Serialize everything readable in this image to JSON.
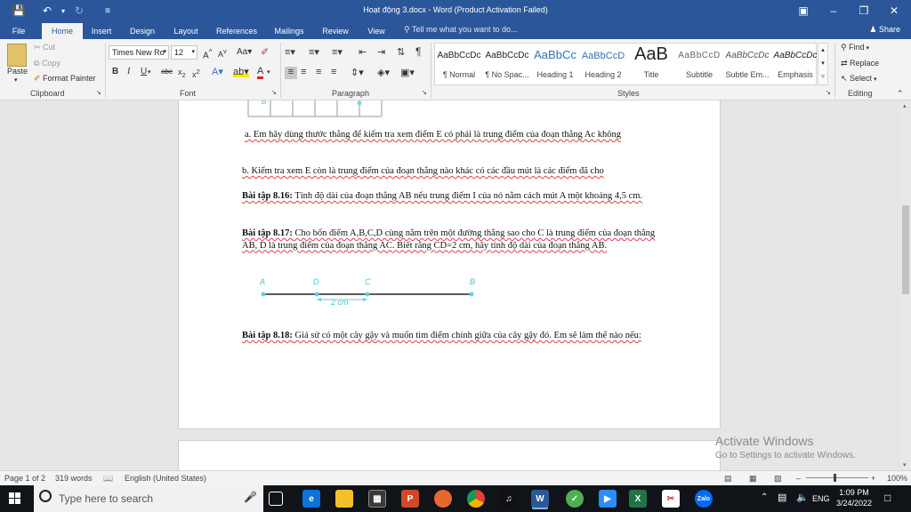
{
  "titlebar": {
    "title": "Hoạt động 3.docx - Word (Product Activation Failed)"
  },
  "tabs": {
    "file": "File",
    "home": "Home",
    "insert": "Insert",
    "design": "Design",
    "layout": "Layout",
    "references": "References",
    "mailings": "Mailings",
    "review": "Review",
    "view": "View",
    "tell_me": "Tell me what you want to do...",
    "share": "Share"
  },
  "clipboard": {
    "paste": "Paste",
    "cut": "Cut",
    "copy": "Copy",
    "format_painter": "Format Painter",
    "label": "Clipboard"
  },
  "font": {
    "family": "Times New Ro",
    "size": "12",
    "label": "Font"
  },
  "paragraph": {
    "label": "Paragraph"
  },
  "styles": {
    "label": "Styles",
    "items": [
      {
        "preview": "AaBbCcDc",
        "name": "¶ Normal"
      },
      {
        "preview": "AaBbCcDc",
        "name": "¶ No Spac..."
      },
      {
        "preview": "AaBbCc",
        "name": "Heading 1"
      },
      {
        "preview": "AaBbCcD",
        "name": "Heading 2"
      },
      {
        "preview": "AaB",
        "name": "Title"
      },
      {
        "preview": "AaBbCcD",
        "name": "Subtitle"
      },
      {
        "preview": "AaBbCcDc",
        "name": "Subtle Em..."
      },
      {
        "preview": "AaBbCcDc",
        "name": "Emphasis"
      }
    ]
  },
  "editing": {
    "find": "Find",
    "replace": "Replace",
    "select": "Select",
    "label": "Editing"
  },
  "document": {
    "p1": "a. Em hãy dùng thước thẳng để kiểm tra xem điểm E có phải là trung điểm của đoạn thẳng Ac không",
    "p2": "b. Kiểm tra xem E còn là trung điểm của đoạn thẳng nào khác có các đầu mút là các điểm đã cho",
    "p3_bold": "Bài tập 8.16:",
    "p3": " Tính độ dài của đoạn thẳng AB nếu trung điểm I của nó nằm cách mút A một khoảng 4,5 cm.",
    "p4_bold": "Bài tập 8.17:",
    "p4": " Cho bốn điểm A,B,C,D cùng nằm trên một đường thẳng sao cho C là trung điểm của đoạn thẳng AB, D là trung điểm của đoạn thẳng AC. Biết rằng CD=2 cm, hãy tính độ dài của đoạn thẳng AB.",
    "p5_bold": "Bài tập 8.18:",
    "p5": " Giả sử có một cây gậy và muốn tìm điểm chính giữa của cây gậy đó. Em sẽ làm thế nào nếu:",
    "figure": {
      "point_a": "A",
      "point_d": "D",
      "point_c": "C",
      "point_b": "B",
      "measure": "2 cm",
      "table_b": "B"
    }
  },
  "statusbar": {
    "page": "Page 1 of 2",
    "words": "319 words",
    "language": "English (United States)",
    "zoom": "100%"
  },
  "watermark": {
    "line1": "Activate Windows",
    "line2": "Go to Settings to activate Windows."
  },
  "taskbar": {
    "search_placeholder": "Type here to search",
    "time": "1:09 PM",
    "date": "3/24/2022",
    "lang": "ENG"
  }
}
